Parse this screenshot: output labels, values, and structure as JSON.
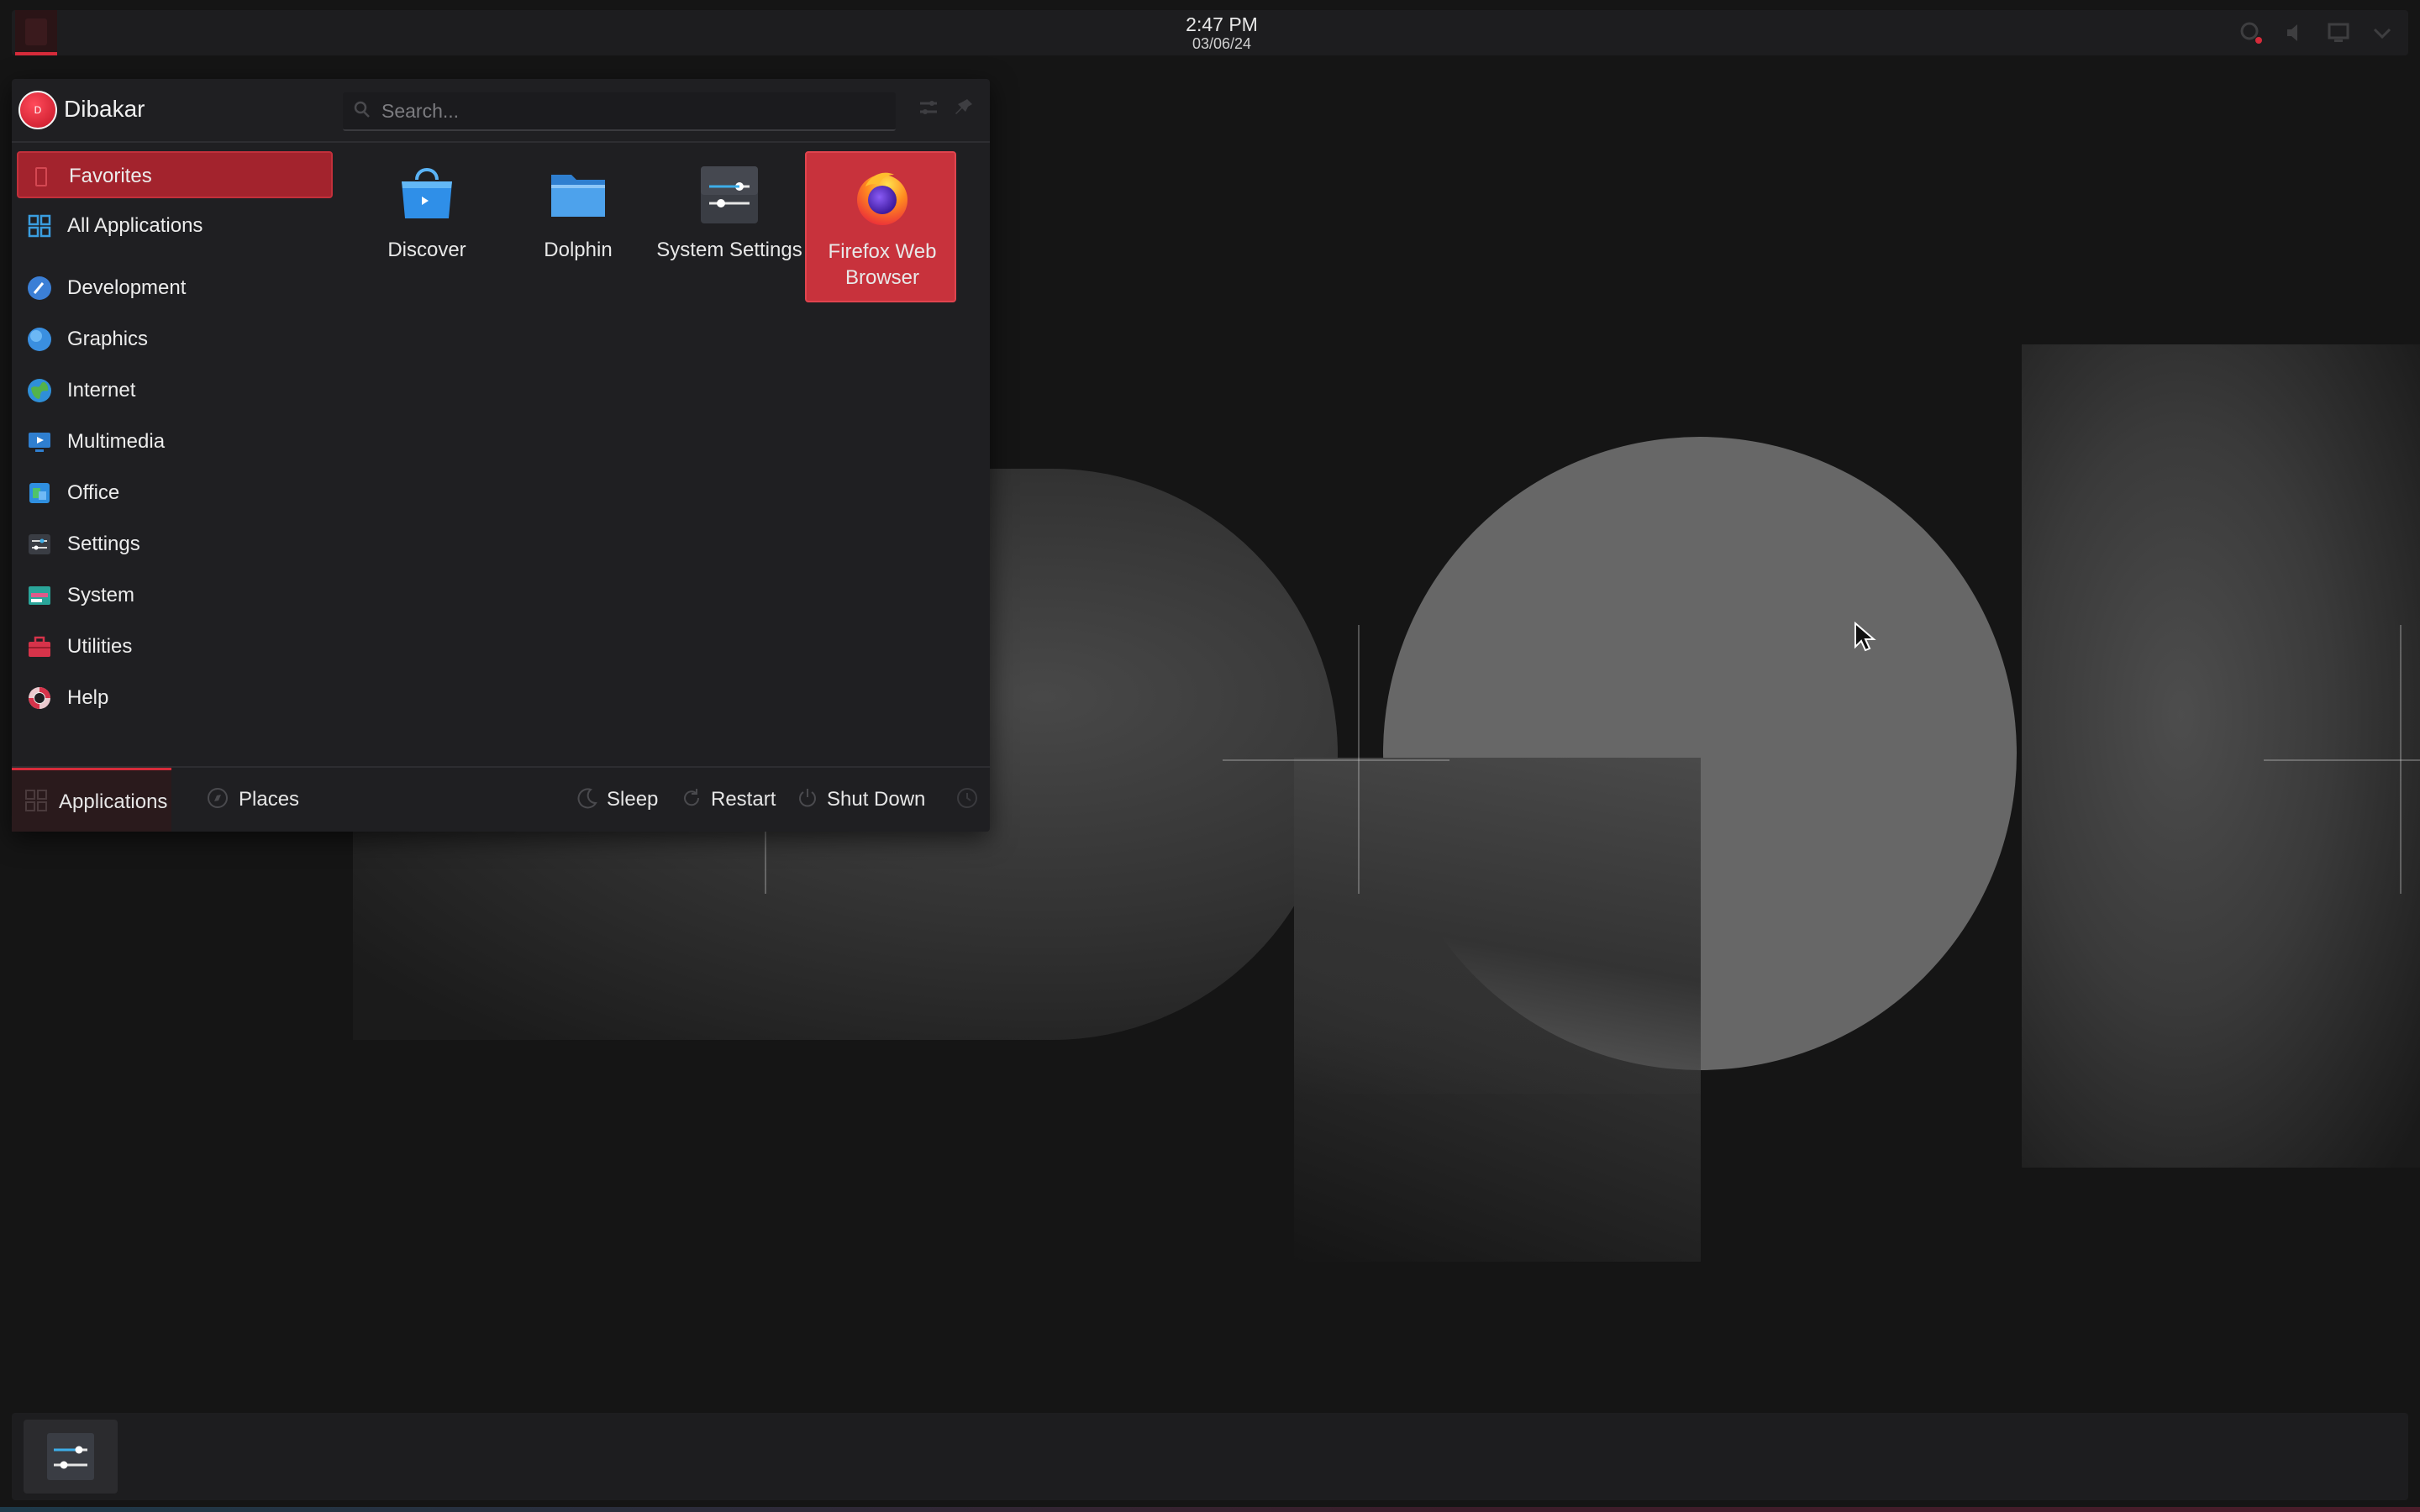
{
  "top_panel": {
    "time": "2:47 PM",
    "date": "03/06/24"
  },
  "user": {
    "name": "Dibakar",
    "avatar_initial": "D"
  },
  "search": {
    "placeholder": "Search..."
  },
  "sidebar": {
    "items": [
      {
        "label": "Favorites",
        "icon": "bookmark-icon",
        "active": true
      },
      {
        "label": "All Applications",
        "icon": "grid-icon"
      },
      {
        "label": "Development",
        "icon": "development-icon"
      },
      {
        "label": "Graphics",
        "icon": "graphics-icon"
      },
      {
        "label": "Internet",
        "icon": "globe-icon"
      },
      {
        "label": "Multimedia",
        "icon": "multimedia-icon"
      },
      {
        "label": "Office",
        "icon": "office-icon"
      },
      {
        "label": "Settings",
        "icon": "settings-icon"
      },
      {
        "label": "System",
        "icon": "system-icon"
      },
      {
        "label": "Utilities",
        "icon": "toolbox-icon"
      },
      {
        "label": "Help",
        "icon": "lifebuoy-icon"
      }
    ]
  },
  "favorites": [
    {
      "label": "Discover",
      "icon": "discover-icon"
    },
    {
      "label": "Dolphin",
      "icon": "folder-icon"
    },
    {
      "label": "System Settings",
      "icon": "sliders-icon"
    },
    {
      "label": "Firefox Web Browser",
      "icon": "firefox-icon",
      "selected": true
    }
  ],
  "footer": {
    "applications": "Applications",
    "places": "Places",
    "sleep": "Sleep",
    "restart": "Restart",
    "shutdown": "Shut Down"
  },
  "colors": {
    "accent": "#d62b3a",
    "selected_bg": "#c8323c",
    "panel_bg": "#1d1d1f",
    "menu_bg": "#1f1f22"
  }
}
